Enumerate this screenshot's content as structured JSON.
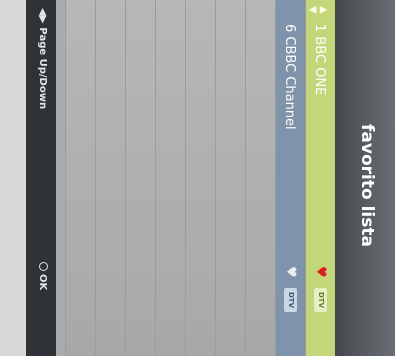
{
  "header": {
    "title": "favorito lista"
  },
  "channels": [
    {
      "label": "1 BBC ONE",
      "favorite": true,
      "badge": "DTV",
      "selected": true
    },
    {
      "label": "6 CBBC Channel",
      "favorite": true,
      "badge": "DTV",
      "selected": false
    }
  ],
  "footer": {
    "nav_label": "Page Up/Down",
    "ok_label": "OK"
  },
  "colors": {
    "selected_row": "#c4d67a",
    "second_row": "#7f93ab",
    "heart_selected": "#d82020"
  },
  "icons": {
    "updown": "updown-arrows-icon",
    "heart": "heart-icon",
    "ok": "ok-circle-icon",
    "nav": "left-right-arrows-icon"
  }
}
